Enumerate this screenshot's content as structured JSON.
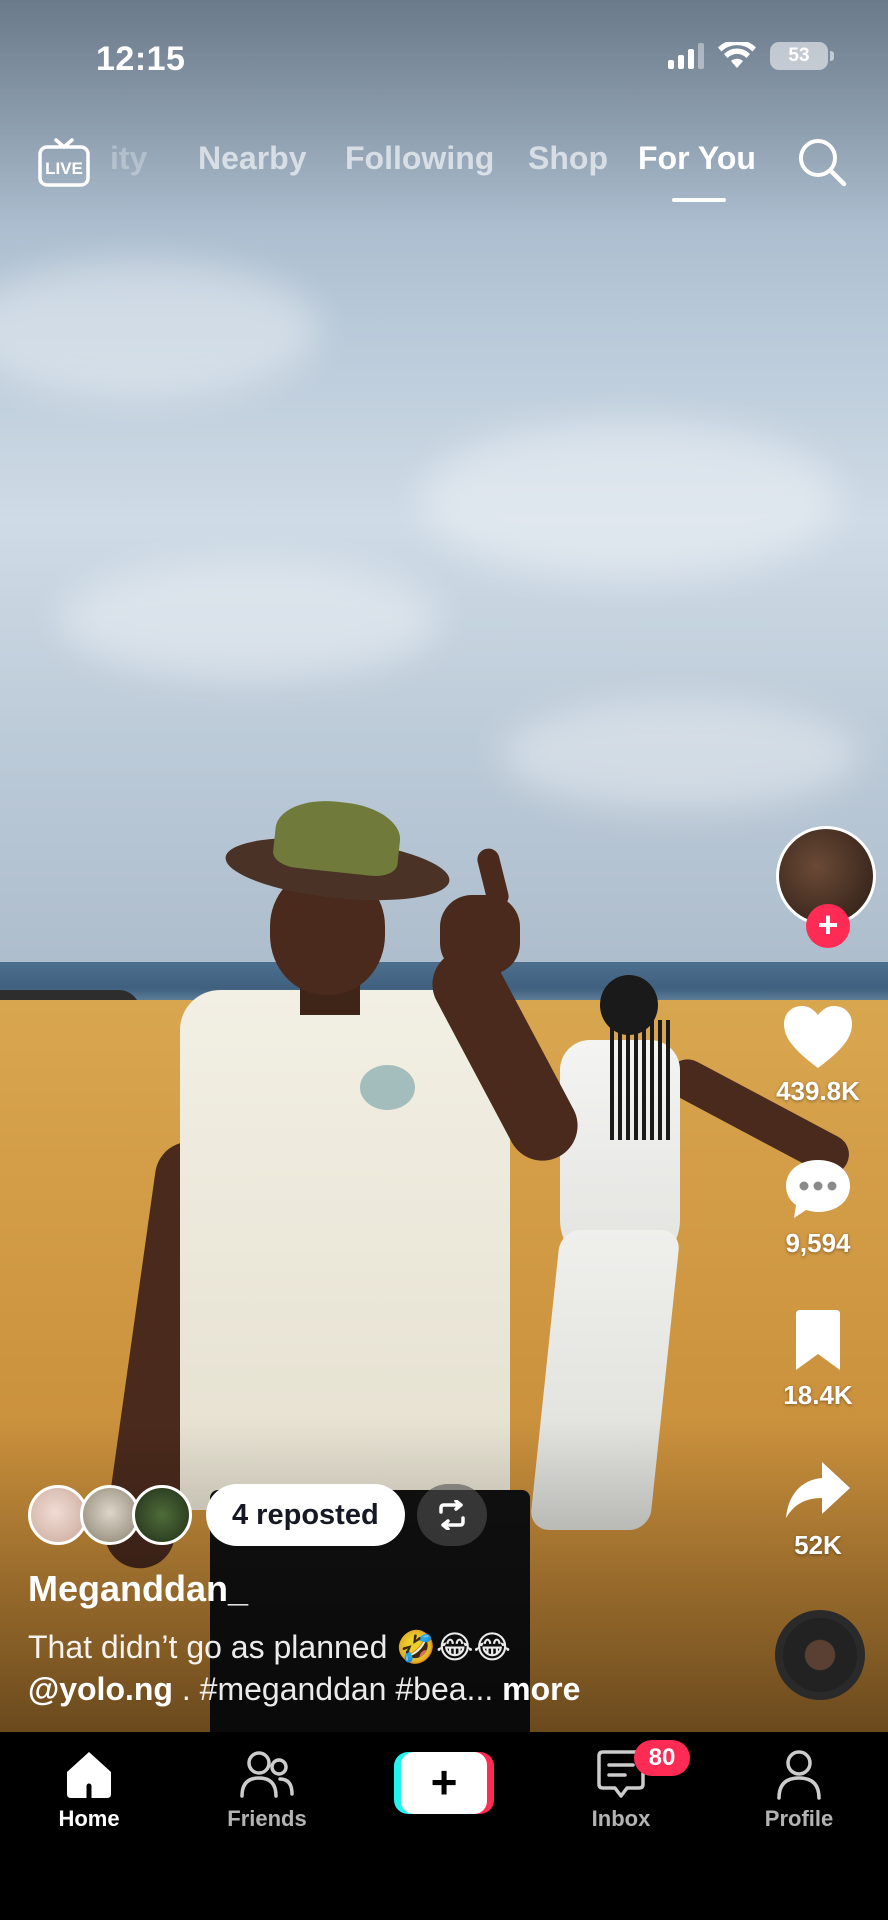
{
  "status_bar": {
    "time": "12:15",
    "battery": "53",
    "icons": [
      "signal-icon",
      "wifi-icon",
      "battery-icon"
    ]
  },
  "top_nav": {
    "live_label": "LIVE",
    "tabs": [
      {
        "label": "ity",
        "active": false
      },
      {
        "label": "Nearby",
        "active": false
      },
      {
        "label": "Following",
        "active": false
      },
      {
        "label": "Shop",
        "active": false
      },
      {
        "label": "For You",
        "active": true
      }
    ],
    "search_icon": "search-icon"
  },
  "actions": {
    "likes": "439.8K",
    "comments": "9,594",
    "saves": "18.4K",
    "shares": "52K",
    "follow_icon": "plus-icon"
  },
  "repost": {
    "label": "4 reposted",
    "icon": "repost-icon"
  },
  "post": {
    "username": "Meganddan_",
    "caption_line1": "That didn’t go as planned 🤣😂😂",
    "mention": "@yolo.ng",
    "caption_line2_rest": " . #meganddan #bea... ",
    "more": "more"
  },
  "tabbar": {
    "home": "Home",
    "friends": "Friends",
    "create": "+",
    "inbox": "Inbox",
    "inbox_badge": "80",
    "profile": "Profile"
  },
  "colors": {
    "accent_red": "#fe2c55",
    "accent_cyan": "#25f4ee",
    "tabbar_bg": "#000000"
  }
}
